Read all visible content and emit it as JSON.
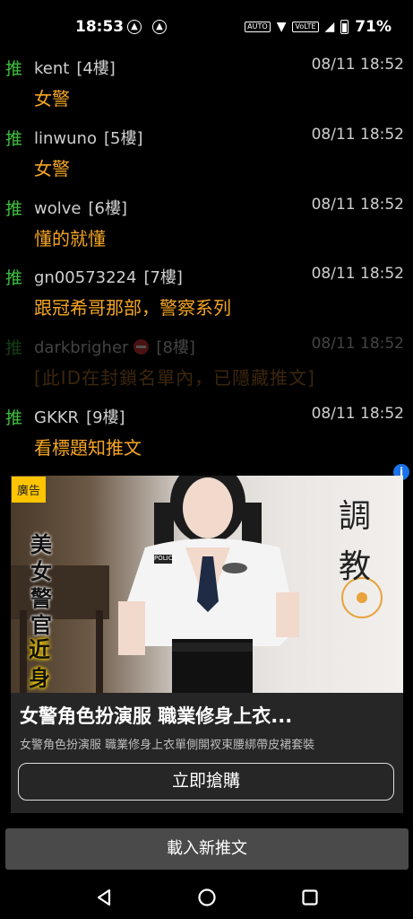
{
  "status": {
    "time": "18:53",
    "battery": "71%",
    "volte": "VoLTE",
    "auto": "AUTO"
  },
  "comments": [
    {
      "tag": "推",
      "user": "kent",
      "floor": "[4樓]",
      "time": "08/11 18:52",
      "text": "女警"
    },
    {
      "tag": "推",
      "user": "linwuno",
      "floor": "[5樓]",
      "time": "08/11 18:52",
      "text": "女警"
    },
    {
      "tag": "推",
      "user": "wolve",
      "floor": "[6樓]",
      "time": "08/11 18:52",
      "text": "懂的就懂"
    },
    {
      "tag": "推",
      "user": "gn00573224",
      "floor": "[7樓]",
      "time": "08/11 18:52",
      "text": "跟冠希哥那部，警察系列"
    },
    {
      "tag": "推",
      "user": "darkbrigher",
      "floor": "[8樓]",
      "time": "08/11 18:52",
      "text": "[此ID在封鎖名單內，已隱藏推文]"
    },
    {
      "tag": "推",
      "user": "GKKR",
      "floor": "[9樓]",
      "time": "08/11 18:52",
      "text": "看標題知推文"
    }
  ],
  "ad": {
    "badge": "廣告",
    "side_text": "美女警官",
    "side_text2": "近身",
    "calligraphy": "調教",
    "patch": "POLICE",
    "title": "女警角色扮演服 職業修身上衣...",
    "description": "女警角色扮演服 職業修身上衣單側開衩束腰綁帶皮裙套裝",
    "cta": "立即搶購",
    "info_icon": "i"
  },
  "load_more": "載入新推文"
}
